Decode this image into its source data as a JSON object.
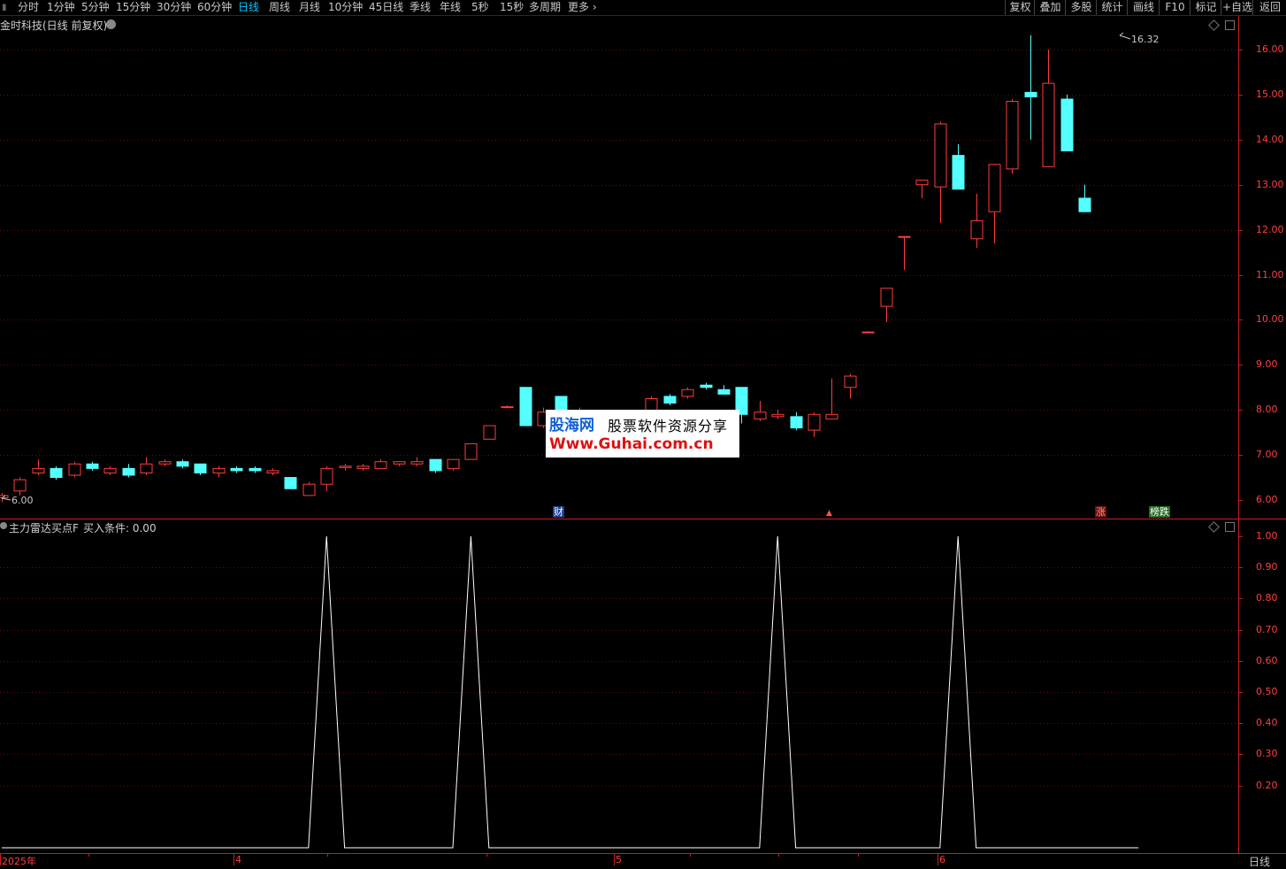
{
  "toolbar": {
    "periods": [
      "分时",
      "1分钟",
      "5分钟",
      "15分钟",
      "30分钟",
      "60分钟",
      "日线",
      "周线",
      "月线",
      "10分钟",
      "45日线",
      "季线",
      "年线",
      "5秒",
      "15秒",
      "多周期",
      "更多"
    ],
    "active_period": "日线",
    "right_buttons": [
      "复权",
      "叠加",
      "多股",
      "统计",
      "画线",
      "F10",
      "标记",
      "+自选",
      "返回"
    ]
  },
  "header": {
    "title": "金时科技(日线 前复权)",
    "indicator_title": "主力雷达买点F",
    "indicator_value": "买入条件: 0.00"
  },
  "annotations": {
    "high_label": "16.32",
    "low_label": "6.00",
    "marker_cai": "财",
    "marker_zhang": "涨",
    "marker_bangdie": "榜跌",
    "marker_arrow": "▲"
  },
  "price_axis": [
    "16.00",
    "15.00",
    "14.00",
    "13.00",
    "12.00",
    "11.00",
    "10.00",
    "9.00",
    "8.00",
    "7.00",
    "6.00"
  ],
  "indicator_axis": [
    "1.00",
    "0.90",
    "0.80",
    "0.70",
    "0.60",
    "0.50",
    "0.40",
    "0.30",
    "0.20"
  ],
  "date_axis": [
    "2025年",
    "4",
    "5",
    "6"
  ],
  "bottom_tab": "日线",
  "watermark": {
    "logo": "股海网",
    "slogan": "股票软件资源分享",
    "url": "Www.Guhai.com.cn"
  },
  "colors": {
    "up": "#ff3c3c",
    "down": "#54ffff",
    "axis": "#c81e1e",
    "grid": "#5a1010",
    "line": "#ffffff"
  },
  "chart_data": [
    {
      "type": "candlestick",
      "ylim": [
        5.8,
        16.5
      ],
      "candles": [
        {
          "o": 6.05,
          "h": 6.15,
          "l": 5.95,
          "c": 6.1
        },
        {
          "o": 6.2,
          "h": 6.5,
          "l": 6.1,
          "c": 6.45
        },
        {
          "o": 6.6,
          "h": 6.9,
          "l": 6.55,
          "c": 6.7
        },
        {
          "o": 6.7,
          "h": 6.75,
          "l": 6.45,
          "c": 6.5
        },
        {
          "o": 6.55,
          "h": 6.85,
          "l": 6.5,
          "c": 6.8
        },
        {
          "o": 6.8,
          "h": 6.85,
          "l": 6.65,
          "c": 6.7
        },
        {
          "o": 6.6,
          "h": 6.75,
          "l": 6.55,
          "c": 6.7
        },
        {
          "o": 6.7,
          "h": 6.8,
          "l": 6.5,
          "c": 6.55
        },
        {
          "o": 6.6,
          "h": 6.95,
          "l": 6.55,
          "c": 6.8
        },
        {
          "o": 6.8,
          "h": 6.9,
          "l": 6.75,
          "c": 6.85
        },
        {
          "o": 6.85,
          "h": 6.9,
          "l": 6.7,
          "c": 6.75
        },
        {
          "o": 6.8,
          "h": 6.8,
          "l": 6.55,
          "c": 6.6
        },
        {
          "o": 6.6,
          "h": 6.75,
          "l": 6.5,
          "c": 6.7
        },
        {
          "o": 6.7,
          "h": 6.75,
          "l": 6.6,
          "c": 6.65
        },
        {
          "o": 6.7,
          "h": 6.75,
          "l": 6.6,
          "c": 6.65
        },
        {
          "o": 6.6,
          "h": 6.7,
          "l": 6.55,
          "c": 6.65
        },
        {
          "o": 6.5,
          "h": 6.5,
          "l": 6.25,
          "c": 6.25
        },
        {
          "o": 6.1,
          "h": 6.4,
          "l": 6.1,
          "c": 6.35
        },
        {
          "o": 6.35,
          "h": 6.75,
          "l": 6.2,
          "c": 6.7
        },
        {
          "o": 6.72,
          "h": 6.8,
          "l": 6.65,
          "c": 6.75
        },
        {
          "o": 6.7,
          "h": 6.8,
          "l": 6.65,
          "c": 6.75
        },
        {
          "o": 6.7,
          "h": 6.9,
          "l": 6.7,
          "c": 6.85
        },
        {
          "o": 6.8,
          "h": 6.85,
          "l": 6.75,
          "c": 6.85
        },
        {
          "o": 6.8,
          "h": 6.95,
          "l": 6.75,
          "c": 6.85
        },
        {
          "o": 6.9,
          "h": 6.9,
          "l": 6.6,
          "c": 6.65
        },
        {
          "o": 6.7,
          "h": 6.9,
          "l": 6.65,
          "c": 6.9
        },
        {
          "o": 6.9,
          "h": 7.25,
          "l": 6.9,
          "c": 7.25
        },
        {
          "o": 7.35,
          "h": 7.65,
          "l": 7.35,
          "c": 7.65
        },
        {
          "o": 8.07,
          "h": 8.1,
          "l": 8.05,
          "c": 8.07
        },
        {
          "o": 8.5,
          "h": 8.5,
          "l": 7.65,
          "c": 7.65
        },
        {
          "o": 7.65,
          "h": 8.05,
          "l": 7.6,
          "c": 7.95
        },
        {
          "o": 8.3,
          "h": 8.3,
          "l": 7.9,
          "c": 7.95
        },
        {
          "o": 7.9,
          "h": 8.05,
          "l": 7.85,
          "c": 7.95
        },
        {
          "o": 7.9,
          "h": 8.0,
          "l": 7.8,
          "c": 7.85
        },
        {
          "o": 7.85,
          "h": 7.95,
          "l": 7.8,
          "c": 7.9
        },
        {
          "o": 7.9,
          "h": 8.0,
          "l": 7.85,
          "c": 7.95
        },
        {
          "o": 7.95,
          "h": 8.3,
          "l": 7.95,
          "c": 8.25
        },
        {
          "o": 8.3,
          "h": 8.35,
          "l": 8.1,
          "c": 8.15
        },
        {
          "o": 8.3,
          "h": 8.5,
          "l": 8.25,
          "c": 8.45
        },
        {
          "o": 8.55,
          "h": 8.6,
          "l": 8.45,
          "c": 8.5
        },
        {
          "o": 8.45,
          "h": 8.55,
          "l": 8.35,
          "c": 8.35
        },
        {
          "o": 8.5,
          "h": 8.5,
          "l": 7.7,
          "c": 7.9
        },
        {
          "o": 7.8,
          "h": 8.2,
          "l": 7.75,
          "c": 7.95
        },
        {
          "o": 7.85,
          "h": 8.0,
          "l": 7.8,
          "c": 7.9
        },
        {
          "o": 7.85,
          "h": 7.95,
          "l": 7.55,
          "c": 7.6
        },
        {
          "o": 7.55,
          "h": 7.95,
          "l": 7.4,
          "c": 7.9
        },
        {
          "o": 7.8,
          "h": 8.7,
          "l": 7.8,
          "c": 7.9
        },
        {
          "o": 8.5,
          "h": 8.8,
          "l": 8.25,
          "c": 8.75
        },
        {
          "o": 9.73,
          "h": 9.75,
          "l": 9.72,
          "c": 9.73
        },
        {
          "o": 10.3,
          "h": 10.7,
          "l": 9.95,
          "c": 10.7
        },
        {
          "o": 11.85,
          "h": 11.85,
          "l": 11.1,
          "c": 11.85
        },
        {
          "o": 13.0,
          "h": 13.1,
          "l": 12.7,
          "c": 13.1
        },
        {
          "o": 12.95,
          "h": 14.4,
          "l": 12.15,
          "c": 14.35
        },
        {
          "o": 13.65,
          "h": 13.9,
          "l": 12.9,
          "c": 12.9
        },
        {
          "o": 11.8,
          "h": 12.8,
          "l": 11.6,
          "c": 12.2
        },
        {
          "o": 12.4,
          "h": 13.45,
          "l": 11.7,
          "c": 13.45
        },
        {
          "o": 13.35,
          "h": 14.9,
          "l": 13.25,
          "c": 14.85
        },
        {
          "o": 15.05,
          "h": 16.32,
          "l": 14.0,
          "c": 14.95
        },
        {
          "o": 13.4,
          "h": 16.0,
          "l": 13.4,
          "c": 15.25
        },
        {
          "o": 14.9,
          "h": 15.0,
          "l": 13.75,
          "c": 13.75
        },
        {
          "o": 12.7,
          "h": 13.0,
          "l": 12.4,
          "c": 12.4
        }
      ]
    },
    {
      "type": "line",
      "name": "买入条件",
      "ylim": [
        0,
        1.0
      ],
      "values": [
        0,
        0,
        0,
        0,
        0,
        0,
        0,
        0,
        0,
        0,
        0,
        0,
        0,
        0,
        0,
        0,
        0,
        0,
        1,
        0,
        0,
        0,
        0,
        0,
        0,
        0,
        1,
        0,
        0,
        0,
        0,
        0,
        0,
        0,
        0,
        0,
        0,
        0,
        0,
        0,
        0,
        0,
        0,
        1,
        0,
        0,
        0,
        0,
        0,
        0,
        0,
        0,
        0,
        1,
        0,
        0,
        0,
        0,
        0,
        0,
        0,
        0,
        0,
        0
      ]
    }
  ]
}
